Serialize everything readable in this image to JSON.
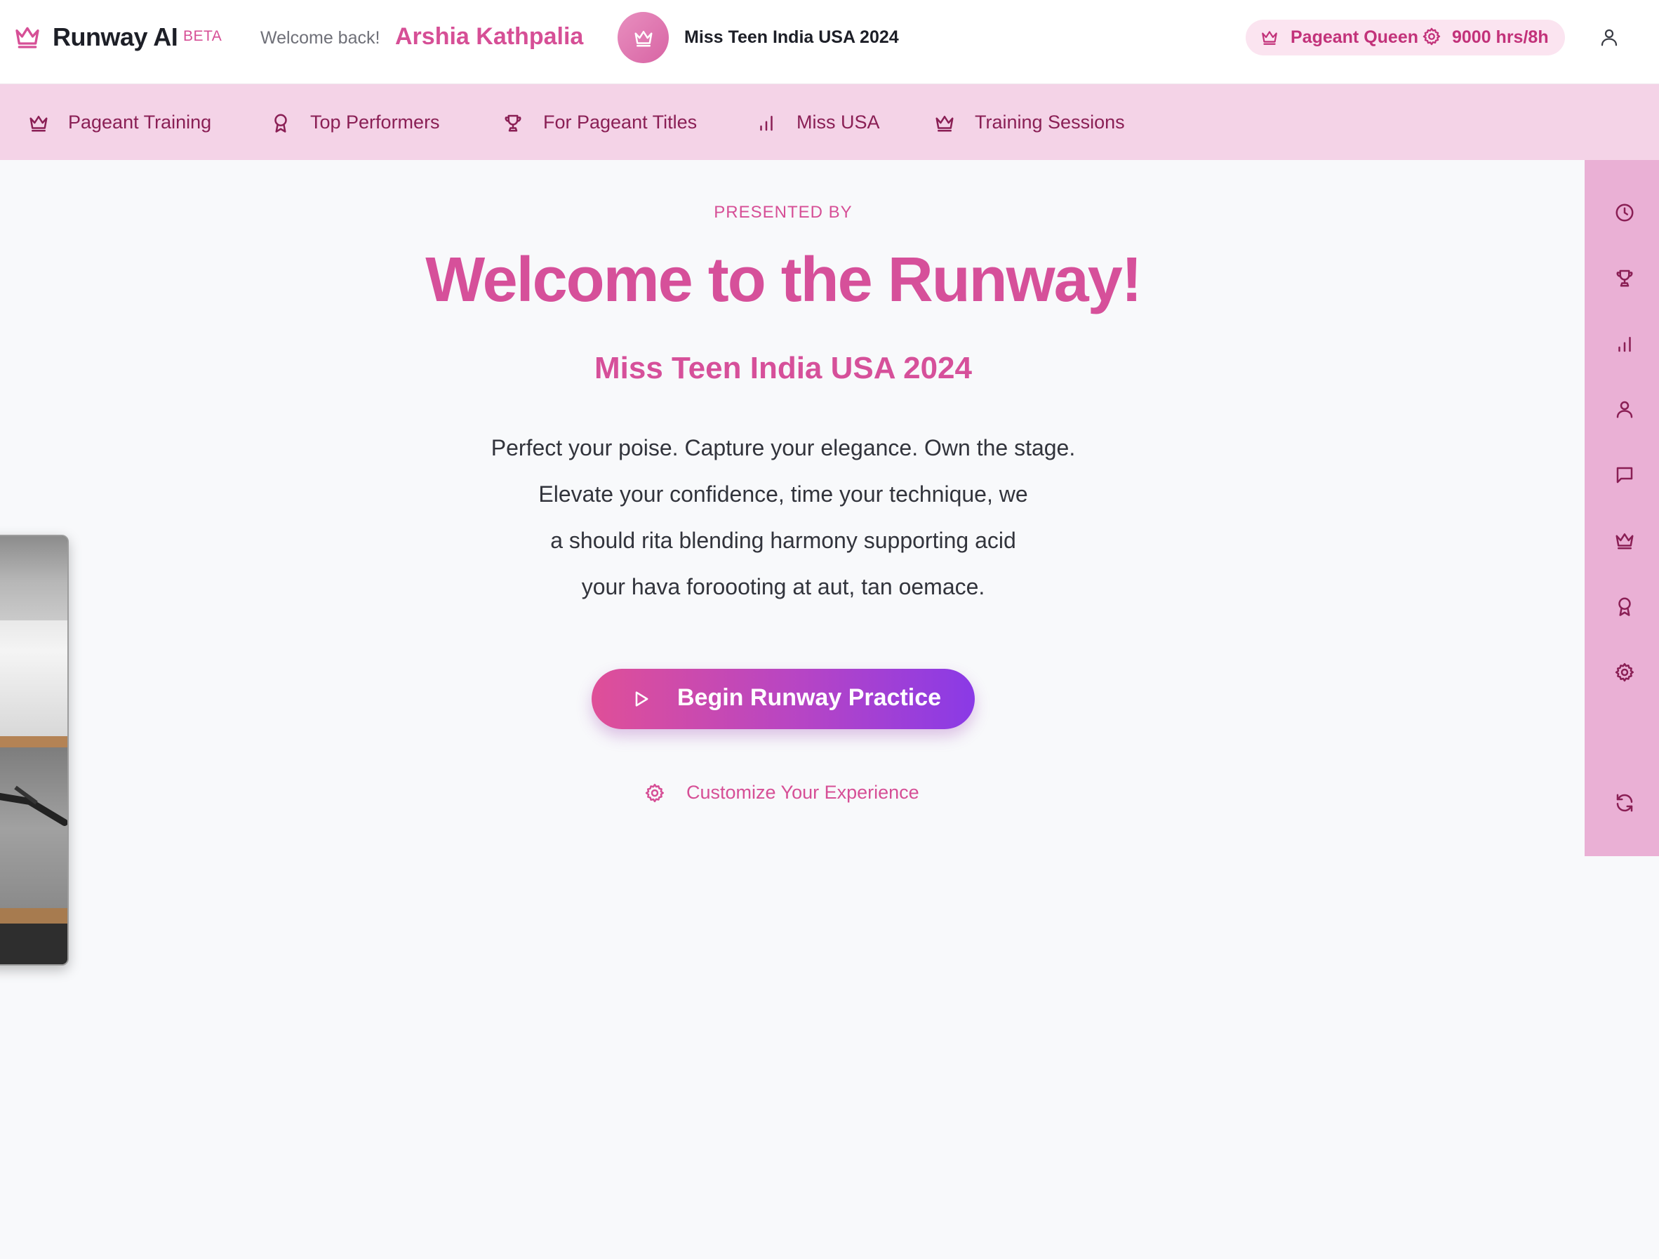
{
  "header": {
    "app_name": "Runway AI",
    "beta_badge": "BETA",
    "welcome_text": "Welcome back!",
    "user_name": "Arshia Kathpalia",
    "event_title": "Miss Teen India USA 2024",
    "status": {
      "rank": "Pageant Queen",
      "hours": "9000 hrs/8h"
    }
  },
  "nav": {
    "items": [
      {
        "label": "Pageant Training",
        "icon": "crown-icon"
      },
      {
        "label": "Top Performers",
        "icon": "award-icon"
      },
      {
        "label": "For Pageant Titles",
        "icon": "trophy-icon"
      },
      {
        "label": "Miss USA",
        "icon": "bar-chart-icon"
      },
      {
        "label": "Training Sessions",
        "icon": "crown-icon"
      }
    ]
  },
  "rail": {
    "icons": [
      "clock-icon",
      "trophy-icon",
      "bar-chart-icon",
      "user-icon",
      "message-icon",
      "crown-icon",
      "award-icon",
      "gear-icon",
      "refresh-icon"
    ]
  },
  "hero": {
    "presented_by": "PRESENTED BY",
    "title": "Welcome to the Runway!",
    "subtitle": "Miss Teen India USA 2024",
    "description": [
      "Perfect your poise. Capture your elegance. Own the stage.",
      "Elevate your confidence, time your technique, we",
      "a should rita blending harmony supporting acid",
      "your hava foroooting at aut, tan oemace."
    ],
    "cta_label": "Begin Runway Practice",
    "customize_label": "Customize Your Experience"
  },
  "colors": {
    "accent": "#d64f96",
    "nav_background": "#f4d3e7",
    "rail_background": "#eab0d5",
    "cta_gradient_start": "#df4f98",
    "cta_gradient_end": "#8a3ae6",
    "page_background": "#f8f9fb"
  }
}
